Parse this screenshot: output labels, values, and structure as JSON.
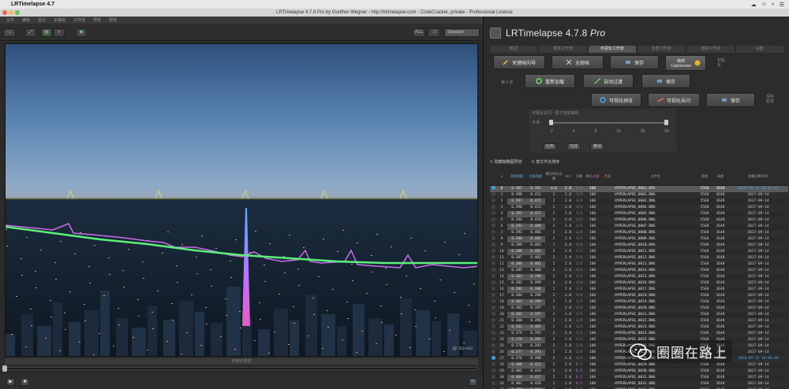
{
  "menubar": {
    "app_name": "LRTimelapse 4.7",
    "items": [
      "文件",
      "编辑",
      "显示",
      "关键帧",
      "工作流",
      "预览",
      "帮助"
    ],
    "sys_icons": [
      "cloud-icon",
      "person-icon",
      "search-icon",
      "list-icon"
    ]
  },
  "window": {
    "title": "LRTimelapse 4.7.8 Pro by Gunther Wegner - http://lrtimelapse.com - CodeCracker, private - Professional License"
  },
  "toolbar": {
    "all_label": "ALL",
    "preset_select": "Standard"
  },
  "preview": {
    "label": "可视化预览",
    "watermark": "@ 3D-AD"
  },
  "right": {
    "logo": "LRTimelapse 4.7.8",
    "logo_suffix": "Pro",
    "tabs": [
      "概况",
      "基本工作流",
      "可视化工作流",
      "全部工作流",
      "渲染工作流",
      "设置"
    ],
    "workflow": {
      "row1": [
        "关键帧向导",
        "全部帧",
        "保存",
        "拖到\nCaptureone"
      ],
      "row2": [
        "重新加载",
        "自动过渡",
        "保存"
      ],
      "row3": [
        "可视化预览",
        "可视化去闪",
        "保存"
      ],
      "row_label_1": "初始\n化",
      "row_label_2": "第 2 步",
      "row_label_3": "保存\n配置"
    },
    "deflicker": {
      "title": "可视化去闪 - 基于当前曲线",
      "smooth_label": "平滑:",
      "ticks": [
        "2",
        "4",
        "8",
        "15",
        "30",
        "60"
      ],
      "buttons": [
        "应用",
        "完成",
        "撤消"
      ]
    },
    "options": [
      "隐藏缩略图预览",
      "按文件名排序"
    ],
    "table": {
      "headers": [
        "",
        "#",
        "亮度测量",
        "后续亮度",
        "曝光时间/光圈",
        "ISO",
        "光圈",
        "曝光/过渡",
        "色温",
        "文件名",
        "宽度",
        "高度",
        "拍摄日期/时间"
      ],
      "rows": [
        [
          "●",
          "0",
          "0.402",
          "0.365",
          "n/a",
          "2.8",
          "1/4",
          "100",
          "HYPERLAPSE_0001.DNG",
          "5568",
          "3648",
          "2018-09-15 18:07:43"
        ],
        [
          "○",
          "1",
          "0.398",
          "0.412",
          "2",
          "2.8",
          "1/4",
          "100",
          "HYPERLAPSE_0002.DNG",
          "5568",
          "3648",
          "2017-09-14"
        ],
        [
          "○",
          "2",
          "0.397",
          "0.415",
          "2",
          "2.8",
          "1/4",
          "100",
          "HYPERLAPSE_0003.DNG",
          "5568",
          "3648",
          "2017-09-14"
        ],
        [
          "○",
          "3",
          "0.396",
          "0.413",
          "2",
          "2.8",
          "1/4",
          "100",
          "HYPERLAPSE_0004.DNG",
          "5568",
          "3648",
          "2017-09-14"
        ],
        [
          "○",
          "4",
          "0.395",
          "0.411",
          "2",
          "2.8",
          "1/4",
          "100",
          "HYPERLAPSE_0005.DNG",
          "5568",
          "3648",
          "2017-09-14"
        ],
        [
          "○",
          "5",
          "0.394",
          "0.410",
          "2",
          "2.8",
          "1/4",
          "100",
          "HYPERLAPSE_0006.DNG",
          "5568",
          "3648",
          "2017-09-14"
        ],
        [
          "○",
          "6",
          "0.393",
          "0.408",
          "2",
          "2.8",
          "1/4",
          "100",
          "HYPERLAPSE_0007.DNG",
          "5568",
          "3648",
          "2017-09-14"
        ],
        [
          "○",
          "7",
          "0.392",
          "0.406",
          "2",
          "2.8",
          "1/4",
          "100",
          "HYPERLAPSE_0008.DNG",
          "5568",
          "3648",
          "2017-09-14"
        ],
        [
          "○",
          "8",
          "0.390",
          "0.405",
          "2",
          "2.8",
          "1/4",
          "100",
          "HYPERLAPSE_0009.DNG",
          "5568",
          "3648",
          "2017-09-14"
        ],
        [
          "○",
          "9",
          "0.389",
          "0.403",
          "1",
          "2.8",
          "1/4",
          "100",
          "HYPERLAPSE_0010.DNG",
          "5568",
          "3648",
          "2017-09-14"
        ],
        [
          "○",
          "10",
          "0.388",
          "0.402",
          "2",
          "2.8",
          "1/4",
          "100",
          "HYPERLAPSE_0011.DNG",
          "5568",
          "3648",
          "2017-09-14"
        ],
        [
          "○",
          "11",
          "0.387",
          "0.403",
          "2",
          "2.8",
          "1/4",
          "100",
          "HYPERLAPSE_0012.DNG",
          "5568",
          "3648",
          "2017-09-14"
        ],
        [
          "○",
          "12",
          "0.386",
          "0.401",
          "2",
          "2.8",
          "1/4",
          "100",
          "HYPERLAPSE_0013.DNG",
          "5568",
          "3648",
          "2017-09-14"
        ],
        [
          "○",
          "13",
          "0.385",
          "0.400",
          "2",
          "2.8",
          "1/4",
          "100",
          "HYPERLAPSE_0014.DNG",
          "5568",
          "3648",
          "2017-09-14"
        ],
        [
          "○",
          "14",
          "0.383",
          "0.398",
          "2",
          "2.8",
          "1/4",
          "100",
          "HYPERLAPSE_0015.DNG",
          "5568",
          "3648",
          "2017-09-14"
        ],
        [
          "○",
          "15",
          "0.382",
          "0.399",
          "3",
          "2.8",
          "1/4",
          "100",
          "HYPERLAPSE_0016.DNG",
          "5568",
          "3648",
          "2017-09-14"
        ],
        [
          "○",
          "16",
          "0.382",
          "0.398",
          "2",
          "2.8",
          "1/4",
          "100",
          "HYPERLAPSE_0017.DNG",
          "5568",
          "3648",
          "2017-09-14"
        ],
        [
          "○",
          "17",
          "0.384",
          "0.398",
          "2",
          "2.8",
          "1/4",
          "100",
          "HYPERLAPSE_0018.DNG",
          "5568",
          "3648",
          "2017-09-14"
        ],
        [
          "○",
          "18",
          "0.383",
          "0.399",
          "2",
          "2.8",
          "1/4",
          "100",
          "HYPERLAPSE_0019.DNG",
          "5568",
          "3648",
          "2017-09-14"
        ],
        [
          "○",
          "19",
          "0.382",
          "0.397",
          "2",
          "2.8",
          "1/4",
          "100",
          "HYPERLAPSE_0020.DNG",
          "5568",
          "3648",
          "2017-09-14"
        ],
        [
          "○",
          "20",
          "0.381",
          "0.397",
          "2",
          "2.8",
          "1/4",
          "100",
          "HYPERLAPSE_0021.DNG",
          "5568",
          "3648",
          "2017-09-14"
        ],
        [
          "○",
          "21",
          "0.380",
          "0.396",
          "2",
          "2.8",
          "1/4",
          "100",
          "HYPERLAPSE_0022.DNG",
          "5568",
          "3648",
          "2017-09-14"
        ],
        [
          "○",
          "22",
          "0.381",
          "0.405",
          "2",
          "2.8",
          "1/4",
          "100",
          "HYPERLAPSE_0023.DNG",
          "5568",
          "3648",
          "2017-09-14"
        ],
        [
          "○",
          "23",
          "0.379",
          "0.393",
          "2",
          "2.8",
          "1/4",
          "100",
          "HYPERLAPSE_0024.DNG",
          "5568",
          "3648",
          "2017-09-14"
        ],
        [
          "○",
          "24",
          "0.378",
          "0.392",
          "2",
          "2.8",
          "1/4",
          "100",
          "HYPERLAPSE_0025.DNG",
          "5568",
          "3648",
          "2017-09-14"
        ],
        [
          "○",
          "25",
          "0.378",
          "0.392",
          "2",
          "2.8",
          "1/4",
          "100",
          "HYPERLAPSE_0026.DNG",
          "5568",
          "3648",
          "2017-09-14"
        ],
        [
          "○",
          "26",
          "0.377",
          "0.391",
          "2",
          "2.8",
          "1/4",
          "100",
          "HYPERLAPSE_0027.DNG",
          "5568",
          "3648",
          "2017-09-14"
        ],
        [
          "●",
          "27",
          "0.376",
          "0.390",
          "2",
          "2.8",
          "1/4",
          "100",
          "HYPERLAPSE_0028.DNG",
          "5568",
          "3648",
          "2018-09-15 19:08:49"
        ],
        [
          "○",
          "28",
          "0.408",
          "0.422",
          "2",
          "2.8",
          "0.5",
          "100",
          "HYPERLAPSE_0029.DNG",
          "5568",
          "3648",
          "2017-09-14"
        ],
        [
          "○",
          "29",
          "0.405",
          "0.419",
          "2",
          "2.8",
          "0.5",
          "100",
          "HYPERLAPSE_0030.DNG",
          "5568",
          "3648",
          "2017-09-14"
        ],
        [
          "○",
          "30",
          "0.404",
          "0.417",
          "2",
          "2.8",
          "0.5",
          "100",
          "HYPERLAPSE_0031.DNG",
          "5568",
          "3648",
          "2017-09-14"
        ],
        [
          "○",
          "31",
          "0.401",
          "0.416",
          "2",
          "2.8",
          "0.5",
          "100",
          "HYPERLAPSE_0032.DNG",
          "5568",
          "3648",
          "2017-09-14"
        ],
        [
          "○",
          "32",
          "0.400",
          "0.414",
          "2",
          "2.8",
          "0.5",
          "100",
          "HYPERLAPSE_0033.DNG",
          "5568",
          "3648",
          "2017-09-14"
        ]
      ]
    }
  },
  "overlay_watermark": "圈圈在路上",
  "colors": {
    "accent_blue": "#3aa0e0",
    "curve_green": "#5cf07a",
    "curve_purple": "#c86ee8",
    "curve_yellow": "#d8d36a"
  }
}
